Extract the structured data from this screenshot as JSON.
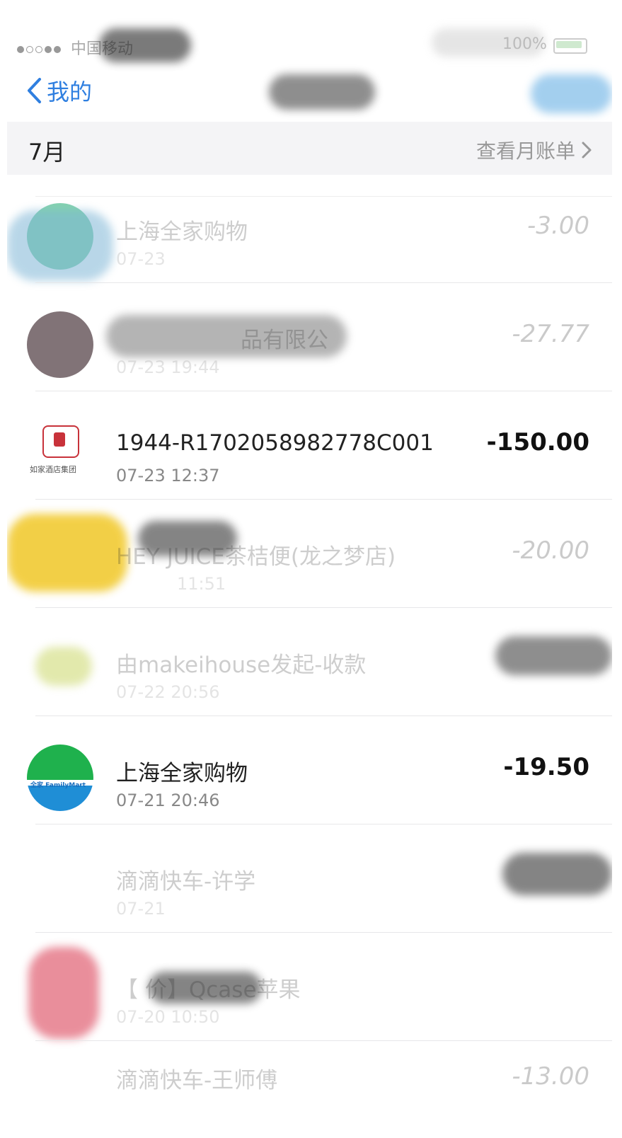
{
  "status": {
    "carrier": "中国移动",
    "battery": "100%"
  },
  "nav": {
    "back_label": "我的"
  },
  "month_header": {
    "label": "7月",
    "link": "查看月账单"
  },
  "transactions": [
    {
      "title": "上海全家购物",
      "time": "07-23",
      "amount": "-3.00",
      "faded": true
    },
    {
      "title": "品有限公",
      "time": "07-23  19:44",
      "amount": "-27.77",
      "faded": true
    },
    {
      "title": "1944-R1702058982778C001",
      "time": "07-23  12:37",
      "amount": "-150.00",
      "faded": false,
      "logo_caption": "如家酒店集团"
    },
    {
      "title": "HEY JUICE茶桔便(龙之梦店)",
      "time": "11:51",
      "amount": "-20.00",
      "faded": true
    },
    {
      "title": "由makeihouse发起-收款",
      "time": "07-22  20:56",
      "amount": "",
      "faded": true
    },
    {
      "title": "上海全家购物",
      "time": "07-21  20:46",
      "amount": "-19.50",
      "faded": false,
      "logo_caption": "全家 FamilyMart"
    },
    {
      "title": "滴滴快车-许学",
      "time": "07-21",
      "amount": "",
      "faded": true
    },
    {
      "title": "【    价】Qcase苹果",
      "time": "07-20  10:50",
      "amount": "",
      "faded": true
    },
    {
      "title": "滴滴快车-王师傅",
      "time": "",
      "amount": "-13.00",
      "faded": true
    }
  ],
  "colors": {
    "accent": "#2f7fe0",
    "familymart_green": "#1fb14d",
    "familymart_blue": "#1f8ed6",
    "hotel_red": "#c8323a"
  }
}
